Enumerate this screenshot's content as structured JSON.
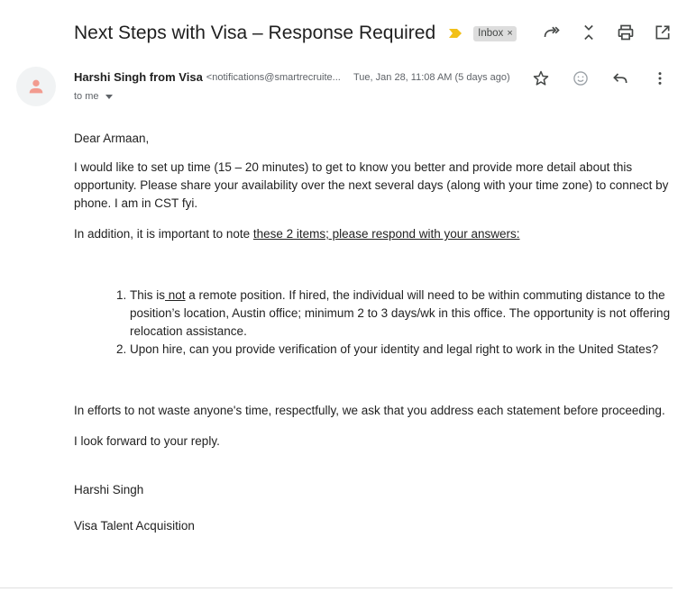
{
  "email": {
    "subject": "Next Steps with Visa – Response Required",
    "label": "Inbox",
    "label_close": "×",
    "sender_name": "Harshi Singh from Visa",
    "sender_email": "<notifications@smartrecruite...",
    "date": "Tue, Jan 28, 11:08 AM (5 days ago)",
    "to": "to me"
  },
  "icons": {
    "importance": "importance-marker-icon",
    "top": [
      "forward-all-icon",
      "collapse-icon",
      "print-icon",
      "open-new-window-icon"
    ],
    "message": [
      "star-icon",
      "emoji-icon",
      "reply-icon",
      "more-vert-icon"
    ]
  },
  "body": {
    "greeting": "Dear Armaan,",
    "p1": "I would like to set up time (15 – 20 minutes) to get to know you better and provide more detail about this opportunity. Please share your availability over the next several days (along with your time zone) to connect by phone.  I am in CST fyi.",
    "p2_pre": "In addition, it is important to note ",
    "p2_underlined": "these 2 items; please respond with your answers:",
    "item1_pre": "This is",
    "item1_not": " not",
    "item1_post": " a remote position. If hired, the individual will need to be within commuting distance to the position’s location, Austin office; minimum 2 to 3 days/wk in this office.  The opportunity is not offering relocation assistance.",
    "item2": "Upon hire, can you provide verification of your identity and legal right to work in the United States?",
    "p3": "In efforts to not waste anyone's time, respectfully, we ask that you address each statement before proceeding.",
    "p4": "I look forward to your reply.",
    "sig_name": "Harshi Singh",
    "sig_title": "Visa Talent Acquisition"
  },
  "colors": {
    "importance": "#f2c018",
    "chip_bg": "#dddddd",
    "avatar_bg": "#f1f3f4",
    "avatar_fg": "#f29b8f"
  }
}
